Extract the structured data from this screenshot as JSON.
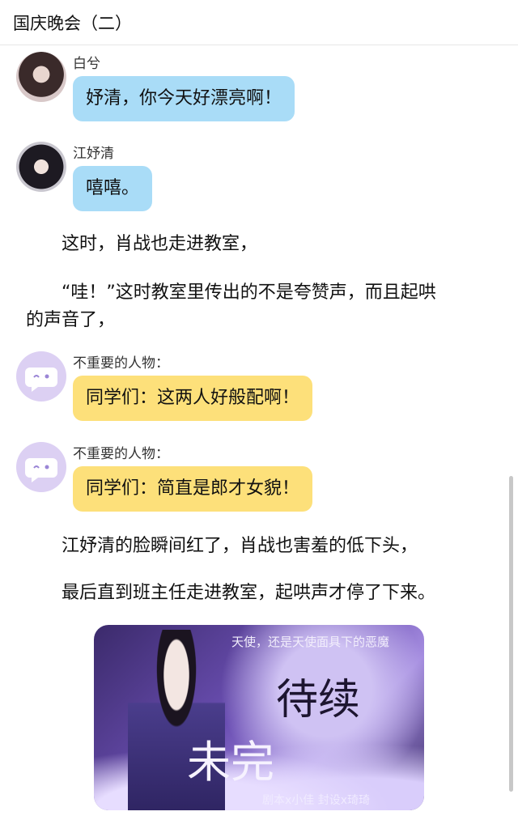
{
  "header": {
    "title": "国庆晚会（二）"
  },
  "messages": [
    {
      "name": "白兮",
      "text": "妤清，你今天好漂亮啊！",
      "avatar": "portrait-photo"
    },
    {
      "name": "江妤清",
      "text": "嘻嘻。",
      "avatar": "portrait-photo"
    },
    {
      "name": "不重要的人物：",
      "text": "同学们：这两人好般配啊！",
      "avatar": "chat-bubble-emoji-icon"
    },
    {
      "name": "不重要的人物：",
      "text": "同学们：简直是郎才女貌！",
      "avatar": "chat-bubble-emoji-icon"
    }
  ],
  "narration": [
    "这时，肖战也走进教室，",
    "“哇！”这时教室里传出的不是夸赞声，而且起哄",
    "的声音了，",
    "江妤清的脸瞬间红了，肖战也害羞的低下头，",
    "最后直到班主任走进教室，起哄声才停了下来。"
  ],
  "poster": {
    "top_line": "天使，还是天使面具下的恶魔",
    "big_text_1": "待续",
    "big_text_2": "未完",
    "credit": "剧本x小佳  封设x琦琦"
  },
  "colors": {
    "blue_bubble": "#a9dcf7",
    "yellow_bubble": "#fde07a",
    "bot_avatar": "#dcd0f3"
  }
}
